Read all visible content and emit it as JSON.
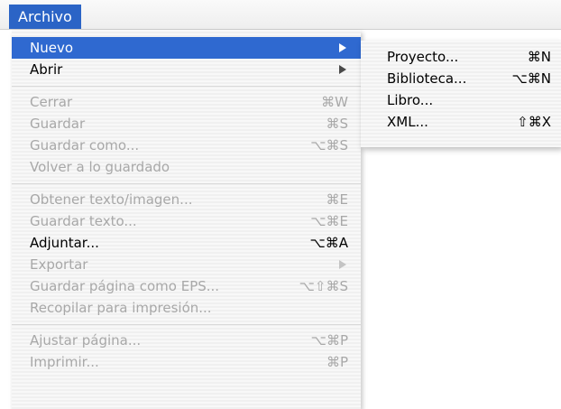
{
  "menubar": {
    "title": "Archivo"
  },
  "menu": {
    "items": [
      {
        "label": "Nuevo",
        "shortcut": "",
        "submenu": true,
        "enabled": true,
        "selected": true
      },
      {
        "label": "Abrir",
        "shortcut": "",
        "submenu": true,
        "enabled": true
      },
      {
        "separator": true
      },
      {
        "label": "Cerrar",
        "shortcut": "⌘W",
        "enabled": false
      },
      {
        "label": "Guardar",
        "shortcut": "⌘S",
        "enabled": false
      },
      {
        "label": "Guardar como...",
        "shortcut": "⌥⌘S",
        "enabled": false
      },
      {
        "label": "Volver a lo guardado",
        "shortcut": "",
        "enabled": false
      },
      {
        "separator": true
      },
      {
        "label": "Obtener texto/imagen...",
        "shortcut": "⌘E",
        "enabled": false
      },
      {
        "label": "Guardar texto...",
        "shortcut": "⌥⌘E",
        "enabled": false
      },
      {
        "label": "Adjuntar...",
        "shortcut": "⌥⌘A",
        "enabled": true
      },
      {
        "label": "Exportar",
        "shortcut": "",
        "submenu": true,
        "enabled": false
      },
      {
        "label": "Guardar página como EPS...",
        "shortcut": "⌥⇧⌘S",
        "enabled": false
      },
      {
        "label": "Recopilar para impresión...",
        "shortcut": "",
        "enabled": false
      },
      {
        "separator": true
      },
      {
        "label": "Ajustar página...",
        "shortcut": "⌥⌘P",
        "enabled": false
      },
      {
        "label": "Imprimir...",
        "shortcut": "⌘P",
        "enabled": false
      }
    ]
  },
  "submenu": {
    "items": [
      {
        "label": "Proyecto...",
        "shortcut": "⌘N"
      },
      {
        "label": "Biblioteca...",
        "shortcut": "⌥⌘N"
      },
      {
        "label": "Libro...",
        "shortcut": ""
      },
      {
        "label": "XML...",
        "shortcut": "⇧⌘X"
      }
    ]
  }
}
